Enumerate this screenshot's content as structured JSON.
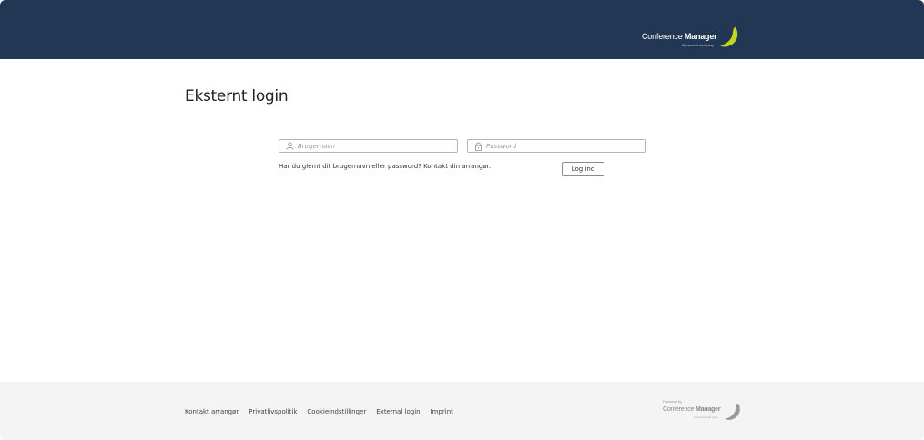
{
  "header": {
    "brand_regular": "Conference",
    "brand_bold": "Manager",
    "brand_tagline": "Advanced and easy",
    "background": "#213753",
    "accent": "#c6d324"
  },
  "page": {
    "title": "Eksternt login"
  },
  "form": {
    "username_placeholder": "Brugernavn",
    "username_value": "",
    "username_icon": "user-icon",
    "password_placeholder": "Password",
    "password_value": "",
    "password_icon": "lock-icon",
    "forgot_text": "Har du glemt dit brugernavn eller password? Kontakt din arrangør.",
    "login_label": "Log ind"
  },
  "footer": {
    "links": [
      "Kontakt arrangør",
      "Privatlivspolitik",
      "Cookieindstillinger",
      "External login",
      "Imprint"
    ],
    "powered_by": "Powered by",
    "brand_regular": "Conference",
    "brand_bold": "Manager",
    "brand_tagline": "Advanced and easy"
  }
}
